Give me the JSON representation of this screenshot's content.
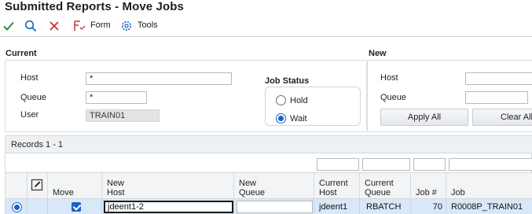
{
  "window": {
    "title": "Submitted Reports - Move Jobs"
  },
  "toolbar": {
    "form_label": "Form",
    "tools_label": "Tools"
  },
  "current": {
    "section_title": "Current",
    "host_label": "Host",
    "host_value": "*",
    "queue_label": "Queue",
    "queue_value": "*",
    "user_label": "User",
    "user_value": "TRAIN01",
    "job_status": {
      "title": "Job Status",
      "options": [
        {
          "label": "Hold",
          "selected": false
        },
        {
          "label": "Wait",
          "selected": true
        }
      ]
    }
  },
  "new": {
    "section_title": "New",
    "host_label": "Host",
    "host_value": "",
    "queue_label": "Queue",
    "queue_value": "",
    "apply_all_label": "Apply All",
    "clear_all_label": "Clear All"
  },
  "grid": {
    "records_label": "Records 1 - 1",
    "columns": {
      "move": "Move",
      "new_host_1": "New",
      "new_host_2": "Host",
      "new_queue_1": "New",
      "new_queue_2": "Queue",
      "current_host_1": "Current",
      "current_host_2": "Host",
      "current_queue_1": "Current",
      "current_queue_2": "Queue",
      "job_num": "Job #",
      "job": "Job"
    },
    "rows": [
      {
        "selected": true,
        "move": true,
        "new_host": "jdeent1-2",
        "new_queue": "",
        "current_host": "jdeent1",
        "current_queue": "RBATCH",
        "job_num": "70",
        "job": "R0008P_TRAIN01"
      }
    ]
  },
  "colors": {
    "accent": "#1a63c4",
    "row_selected": "#d8e8f8",
    "ok_green": "#2e8b3a",
    "cancel_red": "#d0312d"
  }
}
